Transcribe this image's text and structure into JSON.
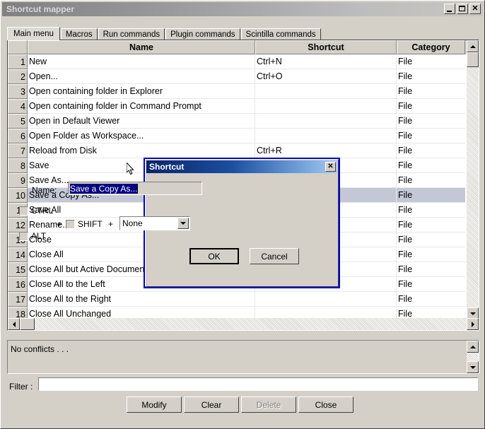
{
  "window": {
    "title": "Shortcut mapper",
    "buttons": {
      "minimize": "minimize-icon",
      "maximize": "maximize-icon",
      "close": "close-icon"
    }
  },
  "tabs": [
    {
      "label": "Main menu",
      "selected": true
    },
    {
      "label": "Macros",
      "selected": false
    },
    {
      "label": "Run commands",
      "selected": false
    },
    {
      "label": "Plugin commands",
      "selected": false
    },
    {
      "label": "Scintilla commands",
      "selected": false
    }
  ],
  "table": {
    "columns": [
      "",
      "Name",
      "Shortcut",
      "Category"
    ],
    "rows": [
      {
        "num": "1",
        "name": "New",
        "shortcut": "Ctrl+N",
        "category": "File",
        "selected": false
      },
      {
        "num": "2",
        "name": "Open...",
        "shortcut": "Ctrl+O",
        "category": "File",
        "selected": false
      },
      {
        "num": "3",
        "name": "Open containing folder in Explorer",
        "shortcut": "",
        "category": "File",
        "selected": false
      },
      {
        "num": "4",
        "name": "Open containing folder in Command Prompt",
        "shortcut": "",
        "category": "File",
        "selected": false
      },
      {
        "num": "5",
        "name": "Open in Default Viewer",
        "shortcut": "",
        "category": "File",
        "selected": false
      },
      {
        "num": "6",
        "name": "Open Folder as Workspace...",
        "shortcut": "",
        "category": "File",
        "selected": false
      },
      {
        "num": "7",
        "name": "Reload from Disk",
        "shortcut": "Ctrl+R",
        "category": "File",
        "selected": false
      },
      {
        "num": "8",
        "name": "Save",
        "shortcut": "",
        "category": "File",
        "selected": false
      },
      {
        "num": "9",
        "name": "Save As...",
        "shortcut": "",
        "category": "File",
        "selected": false
      },
      {
        "num": "10",
        "name": "Save a Copy As...",
        "shortcut": "",
        "category": "File",
        "selected": true
      },
      {
        "num": "11",
        "name": "Save All",
        "shortcut": "",
        "category": "File",
        "selected": false
      },
      {
        "num": "12",
        "name": "Rename...",
        "shortcut": "",
        "category": "File",
        "selected": false
      },
      {
        "num": "13",
        "name": "Close",
        "shortcut": "",
        "category": "File",
        "selected": false
      },
      {
        "num": "14",
        "name": "Close All",
        "shortcut": "",
        "category": "File",
        "selected": false
      },
      {
        "num": "15",
        "name": "Close All but Active Document",
        "shortcut": "",
        "category": "File",
        "selected": false
      },
      {
        "num": "16",
        "name": "Close All to the Left",
        "shortcut": "",
        "category": "File",
        "selected": false
      },
      {
        "num": "17",
        "name": "Close All to the Right",
        "shortcut": "",
        "category": "File",
        "selected": false
      },
      {
        "num": "18",
        "name": "Close All Unchanged",
        "shortcut": "",
        "category": "File",
        "selected": false
      }
    ]
  },
  "conflicts": {
    "text": "No conflicts . . ."
  },
  "filter": {
    "label": "Filter :",
    "value": "",
    "placeholder": ""
  },
  "footer": {
    "modify": "Modify",
    "clear": "Clear",
    "delete": "Delete",
    "close": "Close"
  },
  "dialog": {
    "title": "Shortcut",
    "close_icon": "close-icon",
    "name_label": "Name:",
    "name_value": "Save a Copy As...",
    "ctrl_label": "CTRL",
    "shift_label": "SHIFT",
    "alt_label": "ALT",
    "plus1": "+",
    "plus2": "+",
    "key_value": "None",
    "ok": "OK",
    "cancel": "Cancel"
  },
  "colors": {
    "face": "#d4d0c8",
    "selection": "#c3c7d6",
    "dialog_border": "#0000cd",
    "dialog_title_start": "#0a246a",
    "dialog_title_end": "#a6caf0",
    "text_selection": "#000080"
  }
}
